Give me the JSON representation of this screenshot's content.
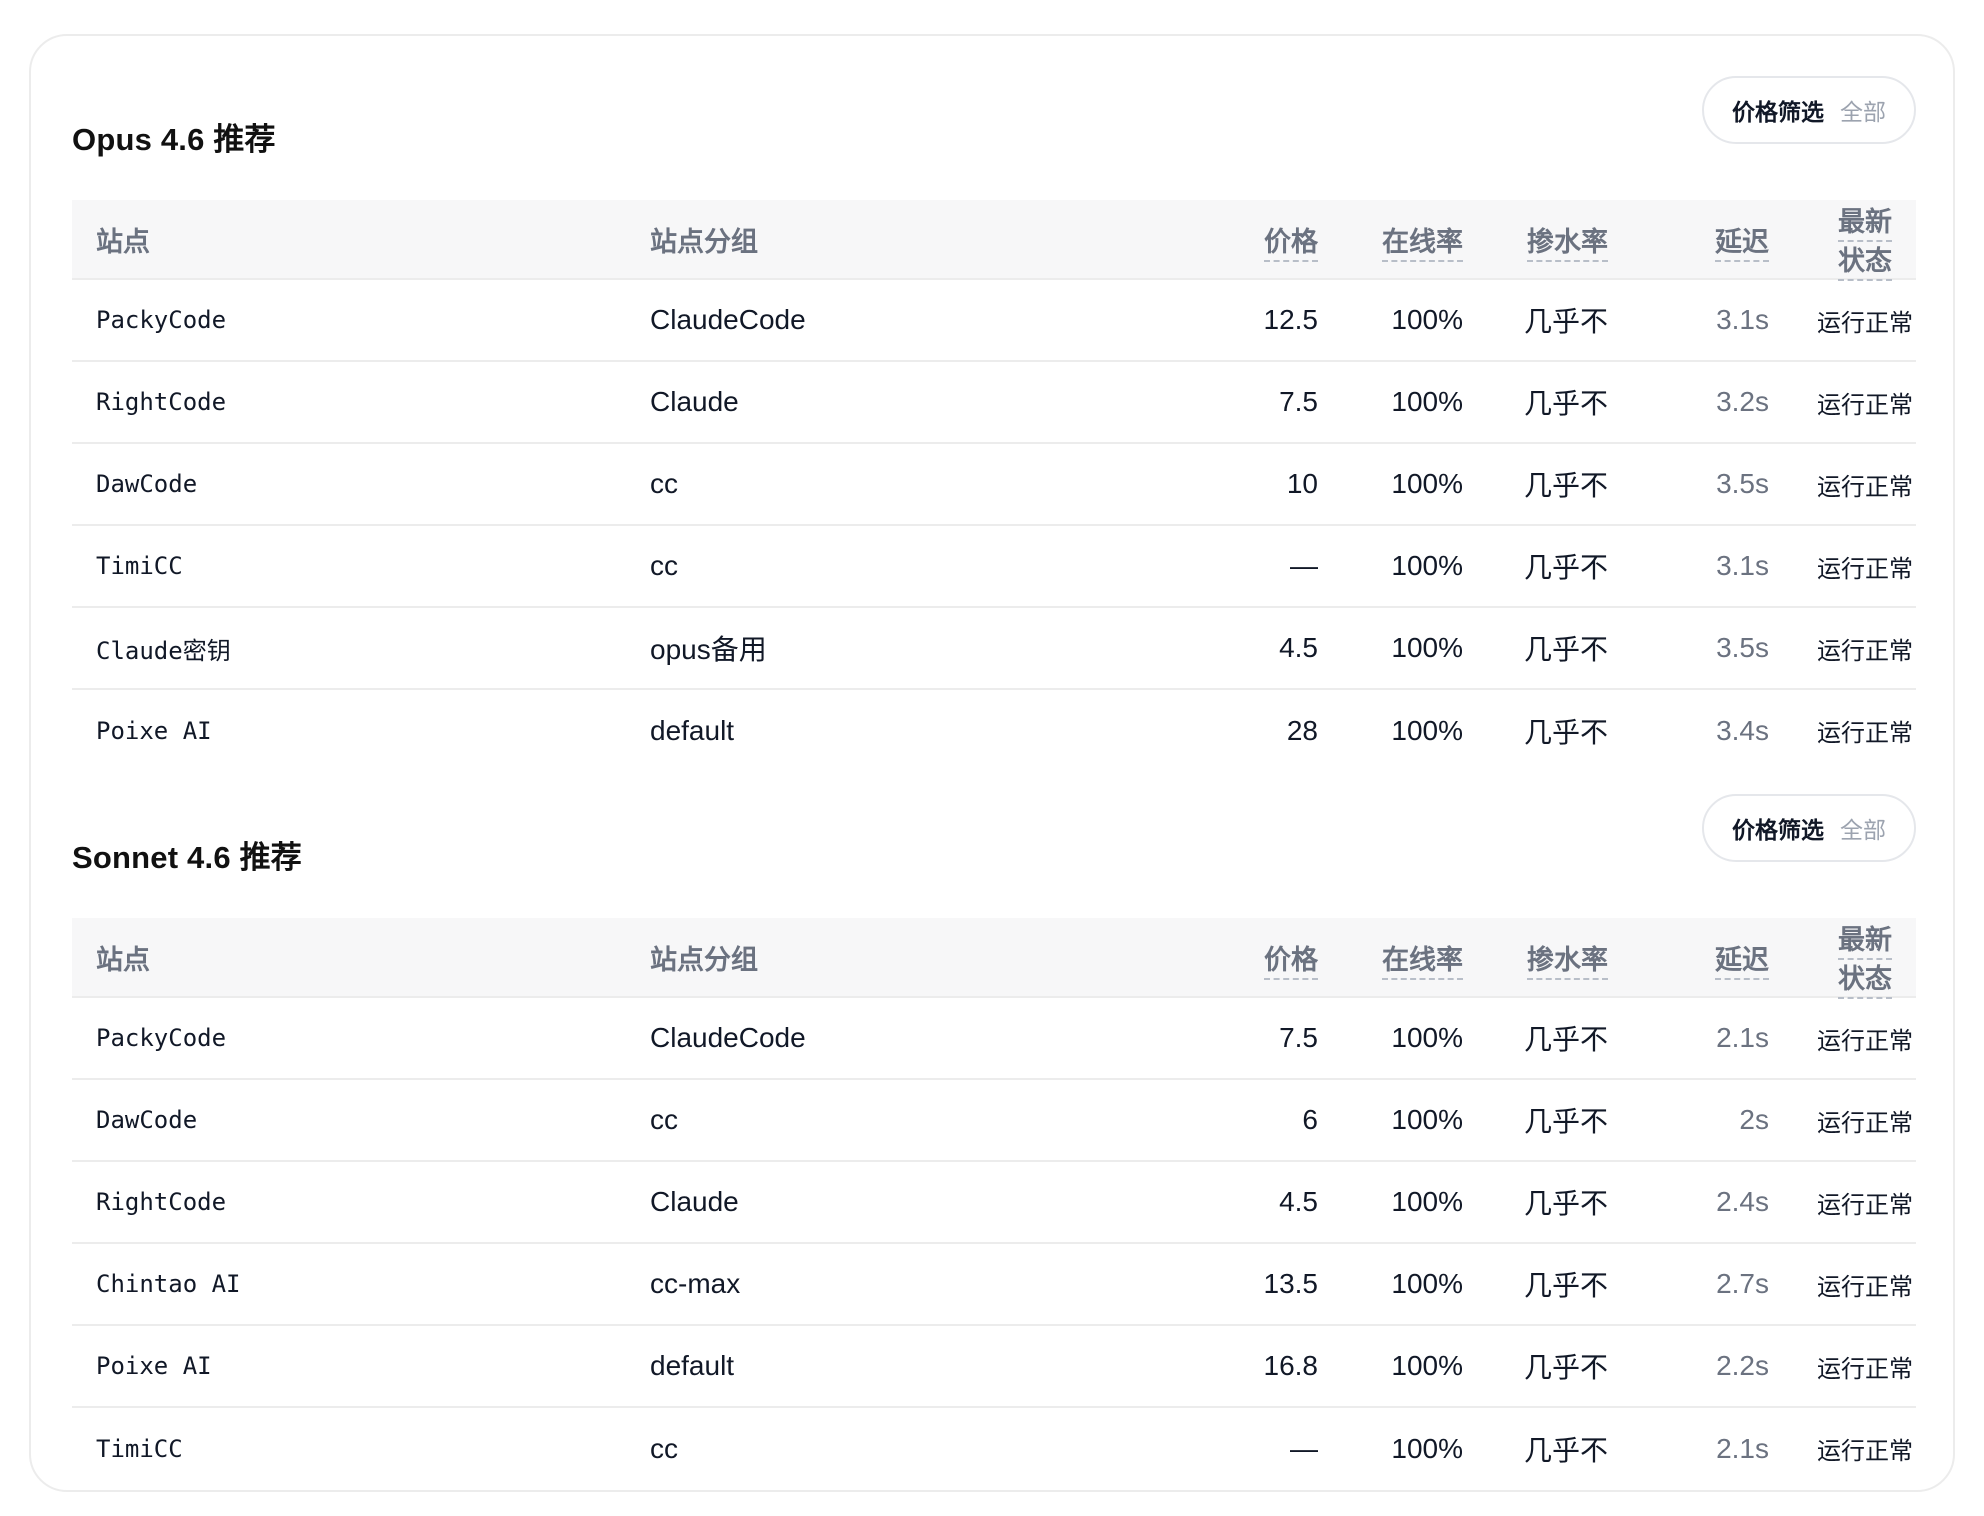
{
  "sections": [
    {
      "title": "Opus 4.6 推荐",
      "filter": {
        "label": "价格筛选",
        "value": "全部"
      },
      "columns": [
        "站点",
        "站点分组",
        "价格",
        "在线率",
        "掺水率",
        "延迟",
        "最新状态"
      ],
      "rows": [
        {
          "site": "PackyCode",
          "group": "ClaudeCode",
          "price": "12.5",
          "online": "100%",
          "water": "几乎不",
          "latency": "3.1s",
          "status": "运行正常"
        },
        {
          "site": "RightCode",
          "group": "Claude",
          "price": "7.5",
          "online": "100%",
          "water": "几乎不",
          "latency": "3.2s",
          "status": "运行正常"
        },
        {
          "site": "DawCode",
          "group": "cc",
          "price": "10",
          "online": "100%",
          "water": "几乎不",
          "latency": "3.5s",
          "status": "运行正常"
        },
        {
          "site": "TimiCC",
          "group": "cc",
          "price": "—",
          "online": "100%",
          "water": "几乎不",
          "latency": "3.1s",
          "status": "运行正常"
        },
        {
          "site": "Claude密钥",
          "group": "opus备用",
          "price": "4.5",
          "online": "100%",
          "water": "几乎不",
          "latency": "3.5s",
          "status": "运行正常"
        },
        {
          "site": "Poixe AI",
          "group": "default",
          "price": "28",
          "online": "100%",
          "water": "几乎不",
          "latency": "3.4s",
          "status": "运行正常"
        }
      ]
    },
    {
      "title": "Sonnet 4.6 推荐",
      "filter": {
        "label": "价格筛选",
        "value": "全部"
      },
      "columns": [
        "站点",
        "站点分组",
        "价格",
        "在线率",
        "掺水率",
        "延迟",
        "最新状态"
      ],
      "rows": [
        {
          "site": "PackyCode",
          "group": "ClaudeCode",
          "price": "7.5",
          "online": "100%",
          "water": "几乎不",
          "latency": "2.1s",
          "status": "运行正常"
        },
        {
          "site": "DawCode",
          "group": "cc",
          "price": "6",
          "online": "100%",
          "water": "几乎不",
          "latency": "2s",
          "status": "运行正常"
        },
        {
          "site": "RightCode",
          "group": "Claude",
          "price": "4.5",
          "online": "100%",
          "water": "几乎不",
          "latency": "2.4s",
          "status": "运行正常"
        },
        {
          "site": "Chintao AI",
          "group": "cc-max",
          "price": "13.5",
          "online": "100%",
          "water": "几乎不",
          "latency": "2.7s",
          "status": "运行正常"
        },
        {
          "site": "Poixe AI",
          "group": "default",
          "price": "16.8",
          "online": "100%",
          "water": "几乎不",
          "latency": "2.2s",
          "status": "运行正常"
        },
        {
          "site": "TimiCC",
          "group": "cc",
          "price": "—",
          "online": "100%",
          "water": "几乎不",
          "latency": "2.1s",
          "status": "运行正常"
        }
      ]
    }
  ]
}
